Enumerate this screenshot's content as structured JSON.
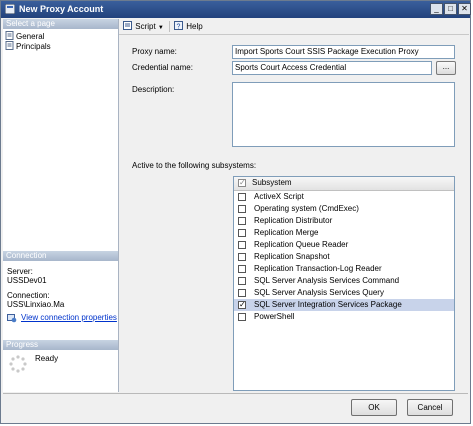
{
  "window": {
    "title": "New Proxy Account",
    "minimize": "_",
    "maximize": "□",
    "close": "✕"
  },
  "sidebar": {
    "select_page_header": "Select a page",
    "pages": [
      {
        "label": "General"
      },
      {
        "label": "Principals"
      }
    ],
    "connection_header": "Connection",
    "server_label": "Server:",
    "server_value": "USSDev01",
    "connection_label": "Connection:",
    "connection_value": "USS\\Linxiao.Ma",
    "view_connection_properties": "View connection properties",
    "progress_header": "Progress",
    "progress_status": "Ready"
  },
  "toolbar": {
    "script_label": "Script",
    "help_label": "Help"
  },
  "form": {
    "proxy_name_label": "Proxy name:",
    "proxy_name_value": "Import Sports Court SSIS Package Execution Proxy",
    "credential_name_label": "Credential name:",
    "credential_name_value": "Sports Court Access Credential",
    "browse_label": "...",
    "description_label": "Description:",
    "description_value": "",
    "subsystems_label": "Active to the following subsystems:"
  },
  "subsystems": {
    "header": "Subsystem",
    "header_checked": true,
    "rows": [
      {
        "label": "ActiveX Script",
        "checked": false
      },
      {
        "label": "Operating system (CmdExec)",
        "checked": false
      },
      {
        "label": "Replication Distributor",
        "checked": false
      },
      {
        "label": "Replication Merge",
        "checked": false
      },
      {
        "label": "Replication Queue Reader",
        "checked": false
      },
      {
        "label": "Replication Snapshot",
        "checked": false
      },
      {
        "label": "Replication Transaction-Log Reader",
        "checked": false
      },
      {
        "label": "SQL Server Analysis Services Command",
        "checked": false
      },
      {
        "label": "SQL Server Analysis Services Query",
        "checked": false
      },
      {
        "label": "SQL Server Integration Services Package",
        "checked": true,
        "selected": true
      },
      {
        "label": "PowerShell",
        "checked": false
      }
    ]
  },
  "buttons": {
    "ok": "OK",
    "cancel": "Cancel"
  }
}
